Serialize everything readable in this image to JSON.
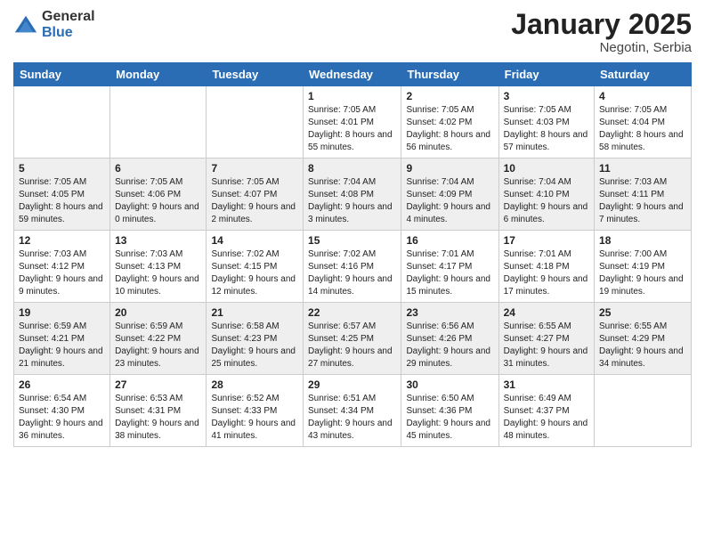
{
  "header": {
    "logo_general": "General",
    "logo_blue": "Blue",
    "month_title": "January 2025",
    "location": "Negotin, Serbia"
  },
  "weekdays": [
    "Sunday",
    "Monday",
    "Tuesday",
    "Wednesday",
    "Thursday",
    "Friday",
    "Saturday"
  ],
  "weeks": [
    [
      {
        "day": "",
        "detail": ""
      },
      {
        "day": "",
        "detail": ""
      },
      {
        "day": "",
        "detail": ""
      },
      {
        "day": "1",
        "detail": "Sunrise: 7:05 AM\nSunset: 4:01 PM\nDaylight: 8 hours and 55 minutes."
      },
      {
        "day": "2",
        "detail": "Sunrise: 7:05 AM\nSunset: 4:02 PM\nDaylight: 8 hours and 56 minutes."
      },
      {
        "day": "3",
        "detail": "Sunrise: 7:05 AM\nSunset: 4:03 PM\nDaylight: 8 hours and 57 minutes."
      },
      {
        "day": "4",
        "detail": "Sunrise: 7:05 AM\nSunset: 4:04 PM\nDaylight: 8 hours and 58 minutes."
      }
    ],
    [
      {
        "day": "5",
        "detail": "Sunrise: 7:05 AM\nSunset: 4:05 PM\nDaylight: 8 hours and 59 minutes."
      },
      {
        "day": "6",
        "detail": "Sunrise: 7:05 AM\nSunset: 4:06 PM\nDaylight: 9 hours and 0 minutes."
      },
      {
        "day": "7",
        "detail": "Sunrise: 7:05 AM\nSunset: 4:07 PM\nDaylight: 9 hours and 2 minutes."
      },
      {
        "day": "8",
        "detail": "Sunrise: 7:04 AM\nSunset: 4:08 PM\nDaylight: 9 hours and 3 minutes."
      },
      {
        "day": "9",
        "detail": "Sunrise: 7:04 AM\nSunset: 4:09 PM\nDaylight: 9 hours and 4 minutes."
      },
      {
        "day": "10",
        "detail": "Sunrise: 7:04 AM\nSunset: 4:10 PM\nDaylight: 9 hours and 6 minutes."
      },
      {
        "day": "11",
        "detail": "Sunrise: 7:03 AM\nSunset: 4:11 PM\nDaylight: 9 hours and 7 minutes."
      }
    ],
    [
      {
        "day": "12",
        "detail": "Sunrise: 7:03 AM\nSunset: 4:12 PM\nDaylight: 9 hours and 9 minutes."
      },
      {
        "day": "13",
        "detail": "Sunrise: 7:03 AM\nSunset: 4:13 PM\nDaylight: 9 hours and 10 minutes."
      },
      {
        "day": "14",
        "detail": "Sunrise: 7:02 AM\nSunset: 4:15 PM\nDaylight: 9 hours and 12 minutes."
      },
      {
        "day": "15",
        "detail": "Sunrise: 7:02 AM\nSunset: 4:16 PM\nDaylight: 9 hours and 14 minutes."
      },
      {
        "day": "16",
        "detail": "Sunrise: 7:01 AM\nSunset: 4:17 PM\nDaylight: 9 hours and 15 minutes."
      },
      {
        "day": "17",
        "detail": "Sunrise: 7:01 AM\nSunset: 4:18 PM\nDaylight: 9 hours and 17 minutes."
      },
      {
        "day": "18",
        "detail": "Sunrise: 7:00 AM\nSunset: 4:19 PM\nDaylight: 9 hours and 19 minutes."
      }
    ],
    [
      {
        "day": "19",
        "detail": "Sunrise: 6:59 AM\nSunset: 4:21 PM\nDaylight: 9 hours and 21 minutes."
      },
      {
        "day": "20",
        "detail": "Sunrise: 6:59 AM\nSunset: 4:22 PM\nDaylight: 9 hours and 23 minutes."
      },
      {
        "day": "21",
        "detail": "Sunrise: 6:58 AM\nSunset: 4:23 PM\nDaylight: 9 hours and 25 minutes."
      },
      {
        "day": "22",
        "detail": "Sunrise: 6:57 AM\nSunset: 4:25 PM\nDaylight: 9 hours and 27 minutes."
      },
      {
        "day": "23",
        "detail": "Sunrise: 6:56 AM\nSunset: 4:26 PM\nDaylight: 9 hours and 29 minutes."
      },
      {
        "day": "24",
        "detail": "Sunrise: 6:55 AM\nSunset: 4:27 PM\nDaylight: 9 hours and 31 minutes."
      },
      {
        "day": "25",
        "detail": "Sunrise: 6:55 AM\nSunset: 4:29 PM\nDaylight: 9 hours and 34 minutes."
      }
    ],
    [
      {
        "day": "26",
        "detail": "Sunrise: 6:54 AM\nSunset: 4:30 PM\nDaylight: 9 hours and 36 minutes."
      },
      {
        "day": "27",
        "detail": "Sunrise: 6:53 AM\nSunset: 4:31 PM\nDaylight: 9 hours and 38 minutes."
      },
      {
        "day": "28",
        "detail": "Sunrise: 6:52 AM\nSunset: 4:33 PM\nDaylight: 9 hours and 41 minutes."
      },
      {
        "day": "29",
        "detail": "Sunrise: 6:51 AM\nSunset: 4:34 PM\nDaylight: 9 hours and 43 minutes."
      },
      {
        "day": "30",
        "detail": "Sunrise: 6:50 AM\nSunset: 4:36 PM\nDaylight: 9 hours and 45 minutes."
      },
      {
        "day": "31",
        "detail": "Sunrise: 6:49 AM\nSunset: 4:37 PM\nDaylight: 9 hours and 48 minutes."
      },
      {
        "day": "",
        "detail": ""
      }
    ]
  ]
}
